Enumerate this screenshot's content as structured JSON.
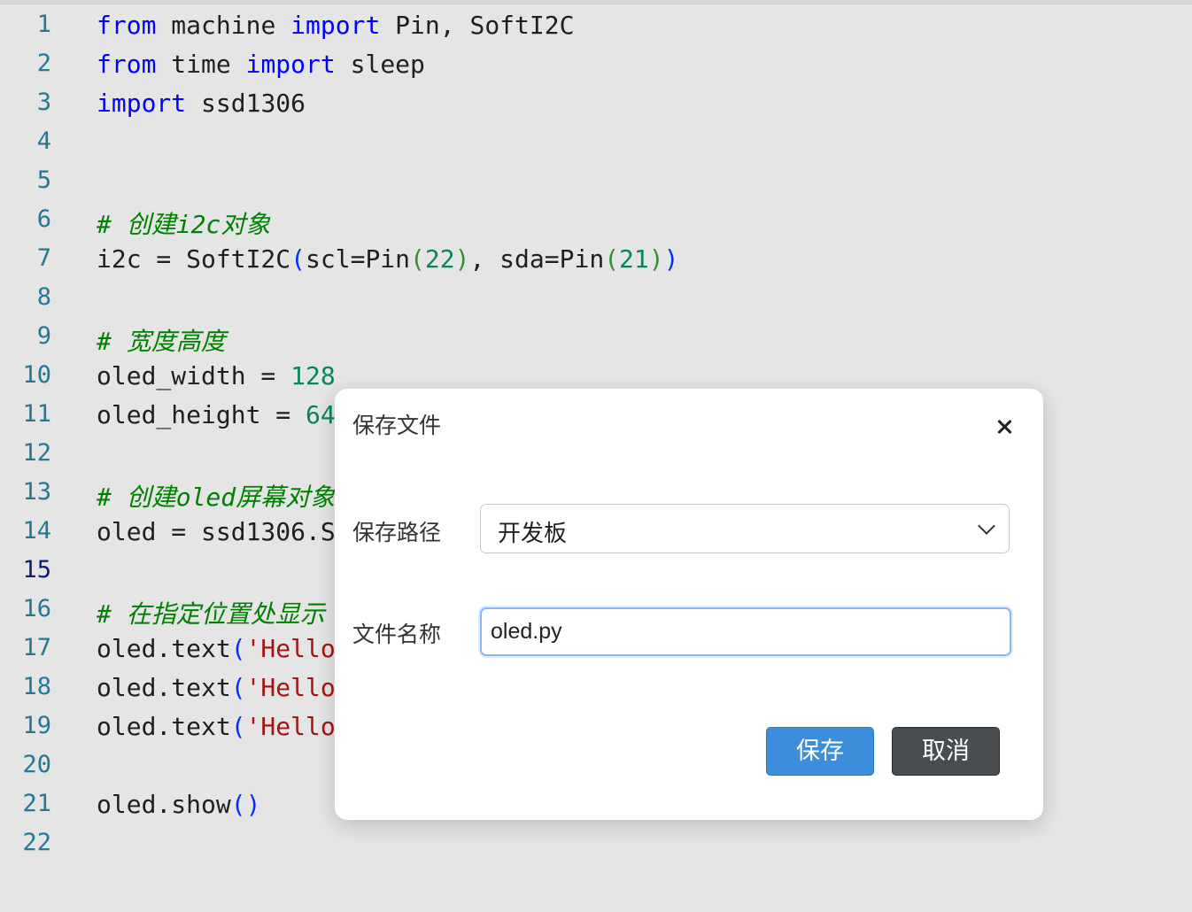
{
  "editor": {
    "lines": [
      {
        "n": "1",
        "tokens": [
          {
            "t": "from",
            "c": "kw"
          },
          {
            "t": " machine "
          },
          {
            "t": "import",
            "c": "kw"
          },
          {
            "t": " Pin, SoftI2C"
          }
        ]
      },
      {
        "n": "2",
        "tokens": [
          {
            "t": "from",
            "c": "kw"
          },
          {
            "t": " time "
          },
          {
            "t": "import",
            "c": "kw"
          },
          {
            "t": " sleep"
          }
        ]
      },
      {
        "n": "3",
        "tokens": [
          {
            "t": "import",
            "c": "kw"
          },
          {
            "t": " ssd1306"
          }
        ]
      },
      {
        "n": "4",
        "tokens": []
      },
      {
        "n": "5",
        "tokens": []
      },
      {
        "n": "6",
        "tokens": [
          {
            "t": "# 创建i2c对象",
            "c": "cm"
          }
        ]
      },
      {
        "n": "7",
        "tokens": [
          {
            "t": "i2c = SoftI2C"
          },
          {
            "t": "(",
            "c": "p1"
          },
          {
            "t": "scl=Pin"
          },
          {
            "t": "(",
            "c": "p2"
          },
          {
            "t": "22",
            "c": "num"
          },
          {
            "t": ")",
            "c": "p2"
          },
          {
            "t": ", sda=Pin"
          },
          {
            "t": "(",
            "c": "p2"
          },
          {
            "t": "21",
            "c": "num"
          },
          {
            "t": ")",
            "c": "p2"
          },
          {
            "t": ")",
            "c": "p1"
          }
        ]
      },
      {
        "n": "8",
        "tokens": []
      },
      {
        "n": "9",
        "tokens": [
          {
            "t": "# 宽度高度",
            "c": "cm"
          }
        ]
      },
      {
        "n": "10",
        "tokens": [
          {
            "t": "oled_width = "
          },
          {
            "t": "128",
            "c": "num"
          }
        ]
      },
      {
        "n": "11",
        "tokens": [
          {
            "t": "oled_height = "
          },
          {
            "t": "64",
            "c": "num"
          }
        ]
      },
      {
        "n": "12",
        "tokens": []
      },
      {
        "n": "13",
        "tokens": [
          {
            "t": "# 创建oled屏幕对象",
            "c": "cm"
          }
        ]
      },
      {
        "n": "14",
        "tokens": [
          {
            "t": "oled = ssd1306.S"
          }
        ]
      },
      {
        "n": "15",
        "tokens": [],
        "active": true
      },
      {
        "n": "16",
        "tokens": [
          {
            "t": "# 在指定位置处显示",
            "c": "cm"
          }
        ]
      },
      {
        "n": "17",
        "tokens": [
          {
            "t": "oled.text"
          },
          {
            "t": "(",
            "c": "p1"
          },
          {
            "t": "'Hello",
            "c": "str"
          }
        ]
      },
      {
        "n": "18",
        "tokens": [
          {
            "t": "oled.text"
          },
          {
            "t": "(",
            "c": "p1"
          },
          {
            "t": "'Hello",
            "c": "str"
          }
        ]
      },
      {
        "n": "19",
        "tokens": [
          {
            "t": "oled.text"
          },
          {
            "t": "(",
            "c": "p1"
          },
          {
            "t": "'Hello",
            "c": "str"
          }
        ]
      },
      {
        "n": "20",
        "tokens": []
      },
      {
        "n": "21",
        "tokens": [
          {
            "t": "oled.show"
          },
          {
            "t": "()",
            "c": "p1"
          }
        ]
      },
      {
        "n": "22",
        "tokens": []
      }
    ]
  },
  "dialog": {
    "title": "保存文件",
    "path_label": "保存路径",
    "path_value": "开发板",
    "name_label": "文件名称",
    "name_value": "oled.py",
    "save_label": "保存",
    "cancel_label": "取消",
    "close_icon": "close-icon"
  },
  "colors": {
    "keyword": "#0000ff",
    "comment": "#008000",
    "number": "#098658",
    "string": "#a31515",
    "line_number": "#237893",
    "save_button": "#3c8ddb",
    "cancel_button": "#4a4d50"
  }
}
